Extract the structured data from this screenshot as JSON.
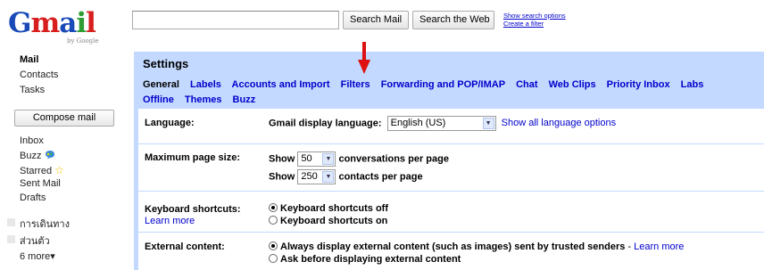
{
  "header": {
    "logo_text": "Gmail",
    "logo_byline": "by Google",
    "search_placeholder": "",
    "search_mail_label": "Search Mail",
    "search_web_label": "Search the Web",
    "show_search_options": "Show search options",
    "create_filter": "Create a filter"
  },
  "sidebar": {
    "items": [
      {
        "label": "Mail"
      },
      {
        "label": "Contacts"
      },
      {
        "label": "Tasks"
      }
    ],
    "compose_label": "Compose mail",
    "folders": [
      {
        "label": "Inbox"
      },
      {
        "label": "Buzz",
        "icon": "buzz-icon"
      },
      {
        "label": "Starred",
        "icon": "star-icon"
      },
      {
        "label": "Sent Mail"
      },
      {
        "label": "Drafts"
      }
    ],
    "labels": [
      {
        "label": "การเดินทาง"
      },
      {
        "label": "ส่วนตัว"
      }
    ],
    "more_label": "6 more▾"
  },
  "settings": {
    "title": "Settings",
    "tabs": [
      "General",
      "Labels",
      "Accounts and Import",
      "Filters",
      "Forwarding and POP/IMAP",
      "Chat",
      "Web Clips",
      "Priority Inbox",
      "Labs",
      "Offline",
      "Themes",
      "Buzz"
    ],
    "active_tab": "General",
    "language": {
      "label": "Language:",
      "caption": "Gmail display language:",
      "value": "English (US)",
      "link": "Show all language options"
    },
    "page_size": {
      "label": "Maximum page size:",
      "show1": "Show",
      "conversations_value": "50",
      "conversations_text": "conversations per page",
      "show2": "Show",
      "contacts_value": "250",
      "contacts_text": "contacts per page"
    },
    "keyboard": {
      "label": "Keyboard shortcuts:",
      "learn_more": "Learn more",
      "option_off": "Keyboard shortcuts off",
      "option_on": "Keyboard shortcuts on",
      "selected": "off"
    },
    "external": {
      "label": "External content:",
      "option_always": "Always display external content (such as images) sent by trusted senders",
      "sep": " - ",
      "learn_more": "Learn more",
      "option_ask": "Ask before displaying external content",
      "selected": "always"
    }
  },
  "colors": {
    "settings_bg": "#c3d9ff",
    "link": "#0000cc",
    "arrow": "#dd1111"
  }
}
